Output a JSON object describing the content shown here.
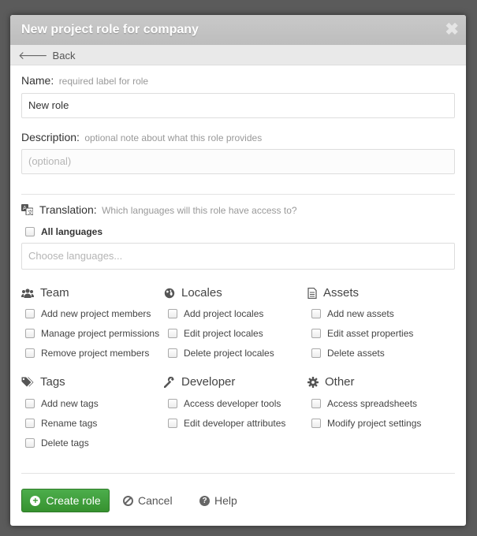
{
  "modal": {
    "title": "New project role for company",
    "close_glyph": "✖",
    "back_label": "Back"
  },
  "name": {
    "label": "Name:",
    "hint": "required label for role",
    "value": "New role"
  },
  "description": {
    "label": "Description:",
    "hint": "optional note about what this role provides",
    "placeholder": "(optional)"
  },
  "translation": {
    "label": "Translation:",
    "hint": "Which languages will this role have access to?",
    "all_languages_label": "All languages",
    "languages_placeholder": "Choose languages..."
  },
  "groups": [
    {
      "title": "Team",
      "icon": "users-icon",
      "items": [
        "Add new project members",
        "Manage project permissions",
        "Remove project members"
      ]
    },
    {
      "title": "Locales",
      "icon": "globe-icon",
      "items": [
        "Add project locales",
        "Edit project locales",
        "Delete project locales"
      ]
    },
    {
      "title": "Assets",
      "icon": "file-icon",
      "items": [
        "Add new assets",
        "Edit asset properties",
        "Delete assets"
      ]
    },
    {
      "title": "Tags",
      "icon": "tags-icon",
      "items": [
        "Add new tags",
        "Rename tags",
        "Delete tags"
      ]
    },
    {
      "title": "Developer",
      "icon": "wrench-icon",
      "items": [
        "Access developer tools",
        "Edit developer attributes"
      ]
    },
    {
      "title": "Other",
      "icon": "gear-icon",
      "items": [
        "Access spreadsheets",
        "Modify project settings"
      ]
    }
  ],
  "footer": {
    "create_label": "Create role",
    "cancel_label": "Cancel",
    "help_label": "Help"
  },
  "colors": {
    "primary_green": "#3ca036",
    "header_gray": "#c4c4c4",
    "overlay": "#4a4a4a"
  }
}
